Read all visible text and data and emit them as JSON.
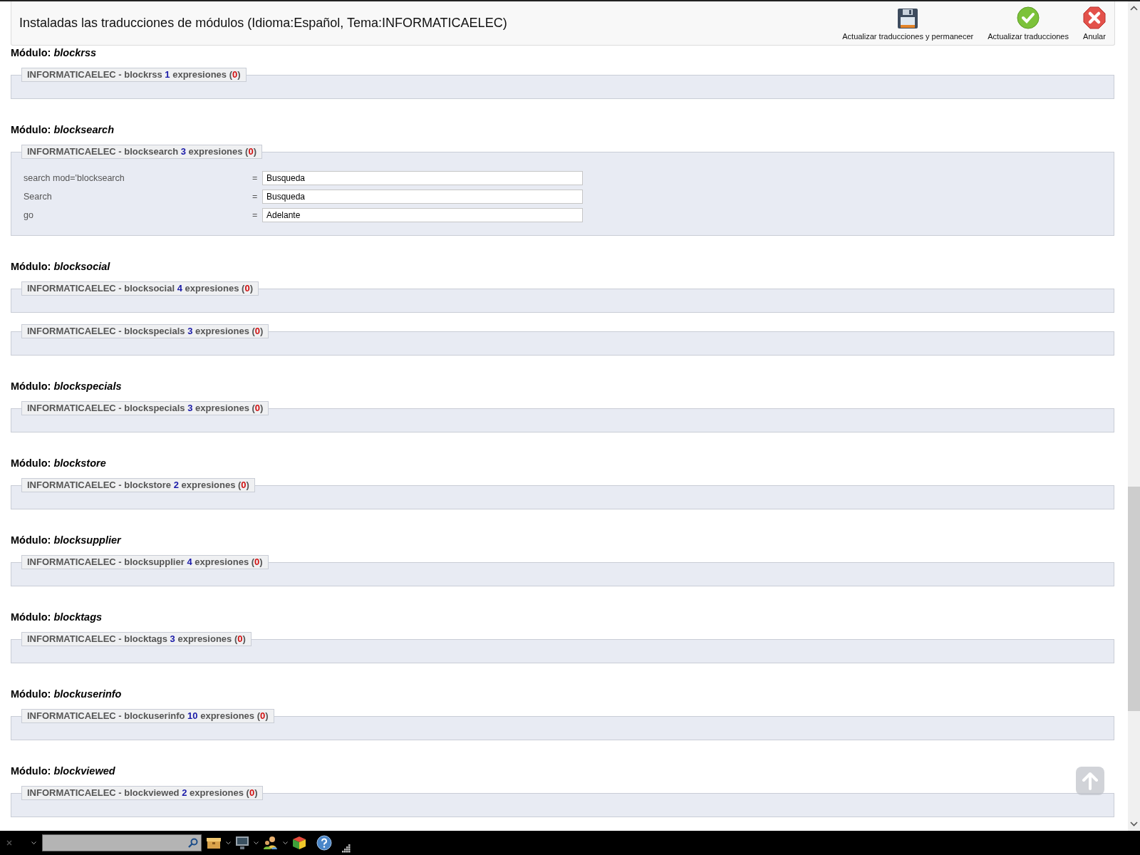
{
  "header": {
    "title": "Instaladas las traducciones de módulos (Idioma:Español, Tema:INFORMATICAELEC)",
    "buttons": [
      {
        "kind": "save",
        "label": "Actualizar traducciones y permanecer"
      },
      {
        "kind": "update",
        "label": "Actualizar traducciones"
      },
      {
        "kind": "cancel",
        "label": "Anular"
      }
    ]
  },
  "modules": [
    {
      "heading": "Módulo: *blockrss*",
      "groups": [
        {
          "prefix": "INFORMATICAELEC - blockrss",
          "count": "1",
          "label": "expresiones",
          "open": "(",
          "missing": "0",
          "close": ")"
        }
      ]
    },
    {
      "heading": "Módulo: *blocksearch*",
      "groups": [
        {
          "prefix": "INFORMATICAELEC - blocksearch",
          "count": "3",
          "label": "expresiones",
          "open": "(",
          "missing": "0",
          "close": ")",
          "rows": [
            {
              "key": "search mod='blocksearch",
              "sign": "=",
              "value": "Busqueda"
            },
            {
              "key": "Search",
              "sign": "=",
              "value": "Busqueda"
            },
            {
              "key": "go",
              "sign": "=",
              "value": "Adelante"
            }
          ]
        }
      ]
    },
    {
      "heading": "Módulo: *blocksocial*",
      "groups": [
        {
          "prefix": "INFORMATICAELEC - blocksocial",
          "count": "4",
          "label": "expresiones",
          "open": "(",
          "missing": "0",
          "close": ")"
        },
        {
          "prefix": "INFORMATICAELEC - blockspecials",
          "count": "3",
          "label": "expresiones",
          "open": "(",
          "missing": "0",
          "close": ")"
        }
      ]
    },
    {
      "heading": "Módulo: *blockspecials*",
      "groups": [
        {
          "prefix": "INFORMATICAELEC - blockspecials",
          "count": "3",
          "label": "expresiones",
          "open": "(",
          "missing": "0",
          "close": ")"
        }
      ]
    },
    {
      "heading": "Módulo: *blockstore*",
      "groups": [
        {
          "prefix": "INFORMATICAELEC - blockstore",
          "count": "2",
          "label": "expresiones",
          "open": "(",
          "missing": "0",
          "close": ")"
        }
      ]
    },
    {
      "heading": "Módulo: *blocksupplier*",
      "groups": [
        {
          "prefix": "INFORMATICAELEC - blocksupplier",
          "count": "4",
          "label": "expresiones",
          "open": "(",
          "missing": "0",
          "close": ")"
        }
      ]
    },
    {
      "heading": "Módulo: *blocktags*",
      "groups": [
        {
          "prefix": "INFORMATICAELEC - blocktags",
          "count": "3",
          "label": "expresiones",
          "open": "(",
          "missing": "0",
          "close": ")"
        }
      ]
    },
    {
      "heading": "Módulo: *blockuserinfo*",
      "groups": [
        {
          "prefix": "INFORMATICAELEC - blockuserinfo",
          "count": "10",
          "label": "expresiones",
          "open": "(",
          "missing": "0",
          "close": ")"
        }
      ]
    },
    {
      "heading": "Módulo: *blockviewed*",
      "groups": [
        {
          "prefix": "INFORMATICAELEC - blockviewed",
          "count": "2",
          "label": "expresiones",
          "open": "(",
          "missing": "0",
          "close": ")"
        }
      ]
    }
  ]
}
